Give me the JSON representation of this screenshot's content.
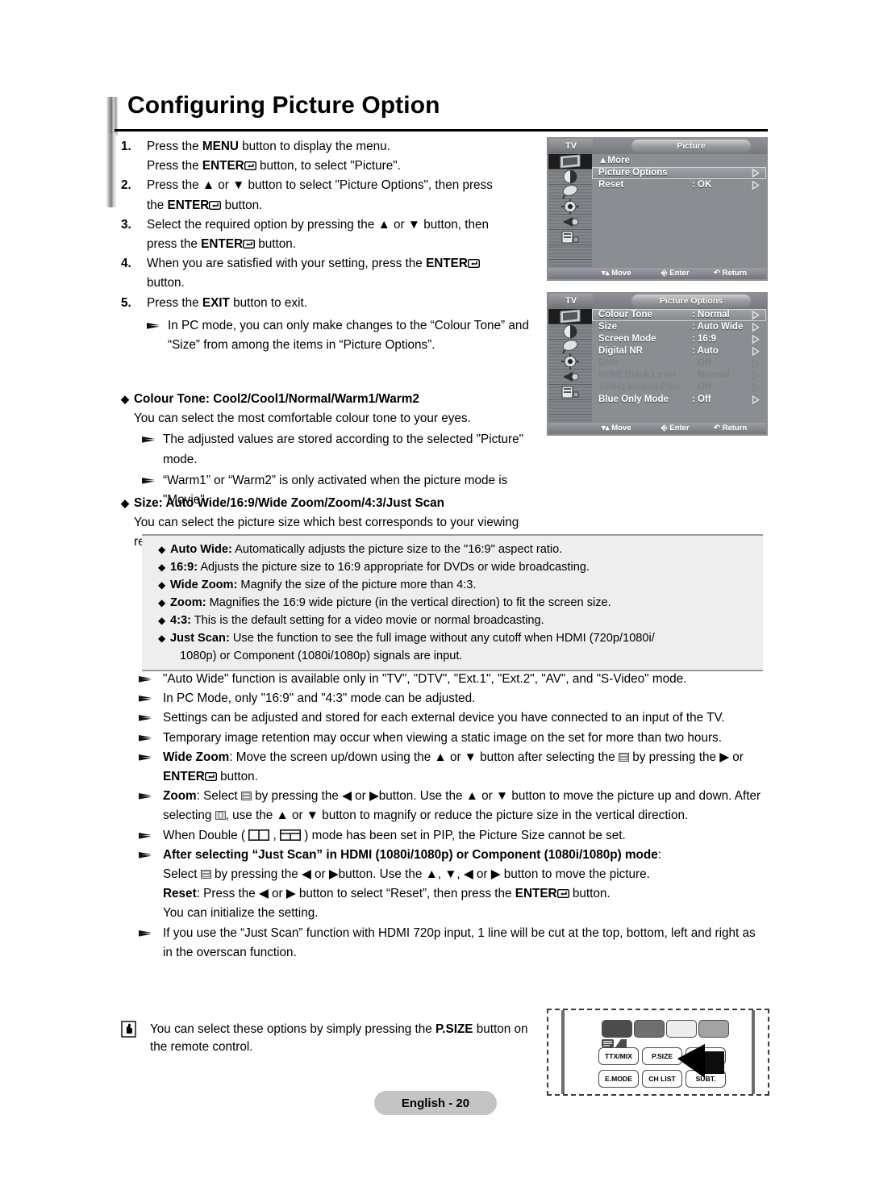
{
  "page": {
    "title": "Configuring Picture Option",
    "footer_label": "English - 20"
  },
  "steps": [
    {
      "num": "1.",
      "lines": [
        [
          {
            "t": "Press the ",
            "b": false
          },
          {
            "t": "MENU",
            "b": true
          },
          {
            "t": " button to display the menu.",
            "b": false
          }
        ],
        [
          {
            "t": "Press the ",
            "b": false
          },
          {
            "t": "ENTER",
            "b": true
          },
          {
            "t": "enter-icon",
            "b": false,
            "icon": true
          },
          {
            "t": " button, to select \"Picture\".",
            "b": false
          }
        ]
      ]
    },
    {
      "num": "2.",
      "lines": [
        [
          {
            "t": "Press the ▲ or ▼ button to select \"Picture Options\", then press",
            "b": false
          }
        ],
        [
          {
            "t": "the ",
            "b": false
          },
          {
            "t": "ENTER",
            "b": true
          },
          {
            "t": "enter-icon",
            "b": false,
            "icon": true
          },
          {
            "t": " button.",
            "b": false
          }
        ]
      ]
    },
    {
      "num": "3.",
      "lines": [
        [
          {
            "t": "Select the required option by pressing the ▲ or ▼ button, then",
            "b": false
          }
        ],
        [
          {
            "t": "press the ",
            "b": false
          },
          {
            "t": "ENTER",
            "b": true
          },
          {
            "t": "enter-icon",
            "b": false,
            "icon": true
          },
          {
            "t": " button.",
            "b": false
          }
        ]
      ]
    },
    {
      "num": "4.",
      "lines": [
        [
          {
            "t": "When you are satisfied with your setting, press the ",
            "b": false
          },
          {
            "t": "ENTER",
            "b": true
          },
          {
            "t": "enter-icon",
            "b": false,
            "icon": true
          }
        ],
        [
          {
            "t": "button.",
            "b": false
          }
        ]
      ]
    },
    {
      "num": "5.",
      "lines": [
        [
          {
            "t": "Press the ",
            "b": false
          },
          {
            "t": "EXIT",
            "b": true
          },
          {
            "t": " button to exit.",
            "b": false
          }
        ]
      ]
    }
  ],
  "step_note": "In PC mode, you can only make changes to the “Colour Tone” and “Size” from among the items in “Picture Options”.",
  "sections": [
    {
      "heading": "Colour Tone: Cool2/Cool1/Normal/Warm1/Warm2",
      "body": "You can select the most comfortable colour tone to your eyes.",
      "notes": [
        "The adjusted values are stored according to the selected \"Picture\" mode.",
        "“Warm1” or “Warm2” is only activated when the picture mode is \"Movie\"."
      ]
    },
    {
      "heading": "Size: Auto Wide/16:9/Wide Zoom/Zoom/4:3/Just Scan",
      "body": "You can select the picture size which best corresponds to your viewing requirements.",
      "notes": []
    }
  ],
  "size_box": [
    {
      "term": "Auto Wide:",
      "desc": " Automatically adjusts the picture size to the \"16:9\" aspect ratio."
    },
    {
      "term": "16:9:",
      "desc": " Adjusts the picture size to 16:9 appropriate for DVDs or wide broadcasting."
    },
    {
      "term": "Wide Zoom:",
      "desc": " Magnify the size of the picture more than 4:3."
    },
    {
      "term": "Zoom:",
      "desc": " Magnifies the 16:9 wide picture (in the vertical direction) to fit the screen size."
    },
    {
      "term": "4:3:",
      "desc": " This is the default setting for a video movie or normal broadcasting."
    },
    {
      "term": "Just Scan:",
      "desc": " Use the function to see the full image without any cutoff when HDMI (720p/1080i/",
      "desc2": "1080p) or Component (1080i/1080p) signals are input."
    }
  ],
  "notes": {
    "n1": "\"Auto Wide\" function is available only in \"TV\", \"DTV\", \"Ext.1\", \"Ext.2\", \"AV\", and \"S-Video\" mode.",
    "n2": "In PC Mode, only \"16:9\" and \"4:3\" mode can be adjusted.",
    "n3": "Settings can be adjusted and stored for each external device you have connected to an input of the TV.",
    "n4": "Temporary image retention may occur when viewing a static image on the set for more than two hours.",
    "n5_term": "Wide Zoom",
    "n5_a": ": Move the screen up/down using the ▲ or ▼ button after selecting the ",
    "n5_b": " by pressing the ▶ or ",
    "n5_enter": "ENTER",
    "n5_c": " button.",
    "n6_term": "Zoom",
    "n6_a": ": Select ",
    "n6_b": " by pressing the ◀ or ▶button. Use the ▲ or ▼ button to move the picture up and down. After selecting ",
    "n6_c": ", use the ▲ or ▼ button to magnify or reduce the picture size in the vertical direction.",
    "n7_a": "When Double ( ",
    "n7_b": " , ",
    "n7_c": " ) mode has been set in PIP, the Picture Size cannot be set.",
    "n8_head": "After selecting “Just Scan” in HDMI (1080i/1080p) or Component (1080i/1080p) mode",
    "n8_colon": ":",
    "n8_l1a": "Select ",
    "n8_l1b": " by pressing the ◀ or ▶button. Use the ▲, ▼, ◀ or ▶ button to move the picture.",
    "n8_reset": "Reset",
    "n8_l2a": ": Press the ◀ or ▶ button to select “Reset”, then press the ",
    "n8_enter": "ENTER",
    "n8_l2b": " button.",
    "n8_l3": "You can initialize the setting.",
    "n9": "If you use the “Just Scan” function with HDMI 720p input, 1 line will be cut at the top, bottom, left and right as in the overscan function."
  },
  "tip": {
    "a": "You can select these options by simply pressing the ",
    "b": "P.SIZE",
    "c": " button on the remote control."
  },
  "osd1": {
    "tv_label": "TV",
    "tab_label": "Picture",
    "more_label": "▲More",
    "rows": [
      {
        "label": "Picture Options",
        "value": "",
        "selected": true,
        "dim": false
      },
      {
        "label": "Reset",
        "value": ": OK",
        "selected": false,
        "dim": false
      }
    ],
    "footer": {
      "move": "Move",
      "enter": "Enter",
      "return": "Return"
    }
  },
  "osd2": {
    "tv_label": "TV",
    "tab_label": "Picture Options",
    "rows": [
      {
        "label": "Colour Tone",
        "value": ": Normal",
        "selected": true,
        "dim": false
      },
      {
        "label": "Size",
        "value": ": Auto Wide",
        "selected": false,
        "dim": false
      },
      {
        "label": "Screen Mode",
        "value": ": 16:9",
        "selected": false,
        "dim": false
      },
      {
        "label": "Digital NR",
        "value": ": Auto",
        "selected": false,
        "dim": false
      },
      {
        "label": "DNIe",
        "value": ": Off",
        "selected": false,
        "dim": true
      },
      {
        "label": "HDMI Black Level",
        "value": ": Normal",
        "selected": false,
        "dim": true
      },
      {
        "label": "100Hz Motion Plus",
        "value": ": Off",
        "selected": false,
        "dim": true
      },
      {
        "label": "Blue Only Mode",
        "value": ": Off",
        "selected": false,
        "dim": false
      }
    ],
    "footer": {
      "move": "Move",
      "enter": "Enter",
      "return": "Return"
    }
  },
  "remote": {
    "keys": [
      {
        "label": "TTX/MIX"
      },
      {
        "label": "P.SIZE"
      },
      {
        "label": "SUBT."
      },
      {
        "label": "E.MODE"
      },
      {
        "label": "CH LIST"
      }
    ]
  },
  "colors": {
    "osd_bg": "#8a8d91",
    "greybox_bg": "#eeeeee",
    "footer_badge": "#c4c4c4"
  }
}
